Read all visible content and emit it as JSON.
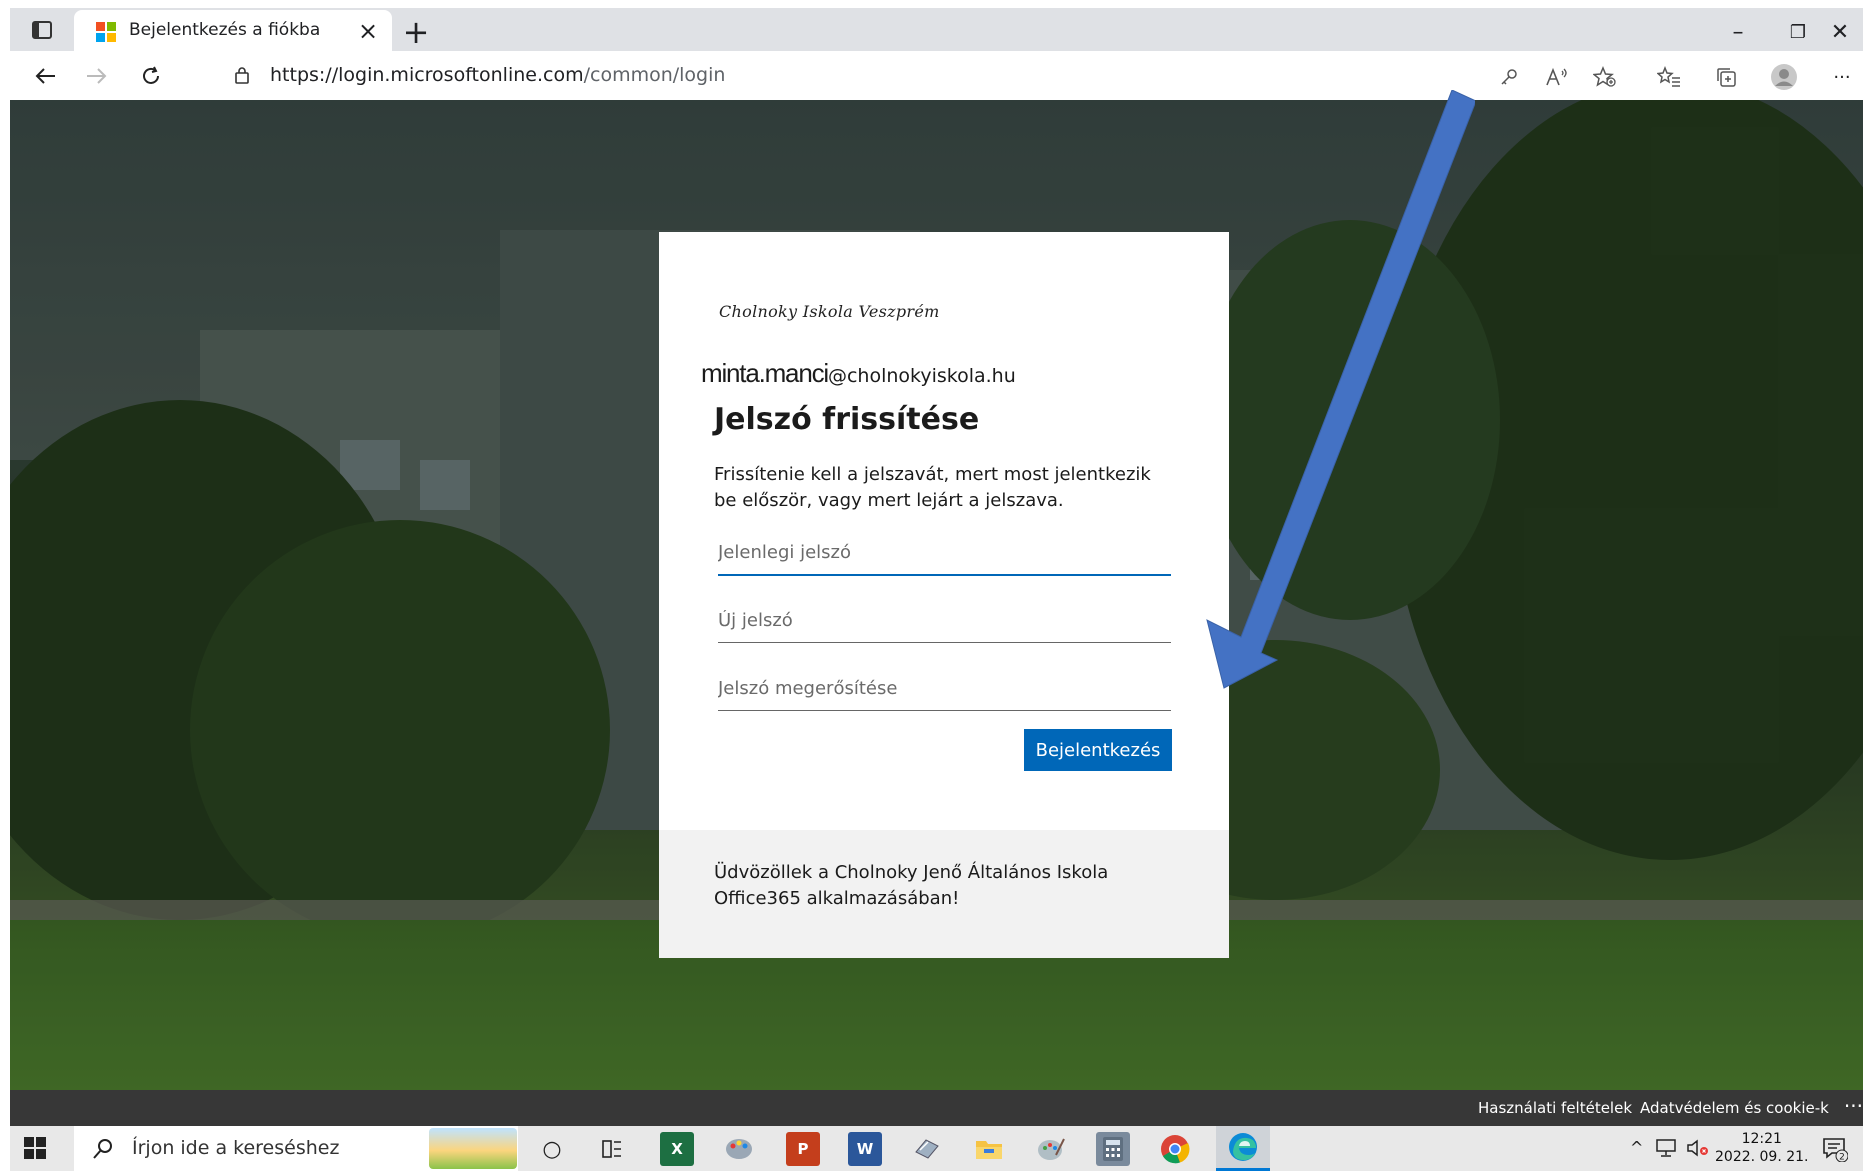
{
  "browser": {
    "tab_title": "Bejelentkezés a fiókba",
    "tab_close": "×",
    "new_tab": "+",
    "url_host": "https://login.microsoftonline.com",
    "url_path": "/common/login",
    "window_minimize": "–",
    "window_restore": "❐",
    "window_close": "✕",
    "more": "···"
  },
  "card": {
    "brand": "Cholnoky Iskola Veszprém",
    "account_user": "minta.manci",
    "account_domain": "@cholnokyiskola.hu",
    "heading": "Jelszó frissítése",
    "description": "Frissítenie kell a jelszavát, mert most jelentkezik be először, vagy mert lejárt a jelszava.",
    "current_password_placeholder": "Jelenlegi jelszó",
    "new_password_placeholder": "Új jelszó",
    "confirm_password_placeholder": "Jelszó megerősítése",
    "submit_label": "Bejelentkezés",
    "footer_text": "Üdvözöllek a Cholnoky Jenő Általános Iskola Office365 alkalmazásában!"
  },
  "page_footer": {
    "terms": "Használati feltételek",
    "privacy": "Adatvédelem és cookie-k",
    "more": "···"
  },
  "taskbar": {
    "search_placeholder": "Írjon ide a kereséshez",
    "time": "12:21",
    "date": "2022. 09. 21.",
    "notification_count": "2"
  },
  "colors": {
    "accent": "#0067b8",
    "arrow": "#4472c4",
    "card_footer": "#f2f2f2"
  }
}
